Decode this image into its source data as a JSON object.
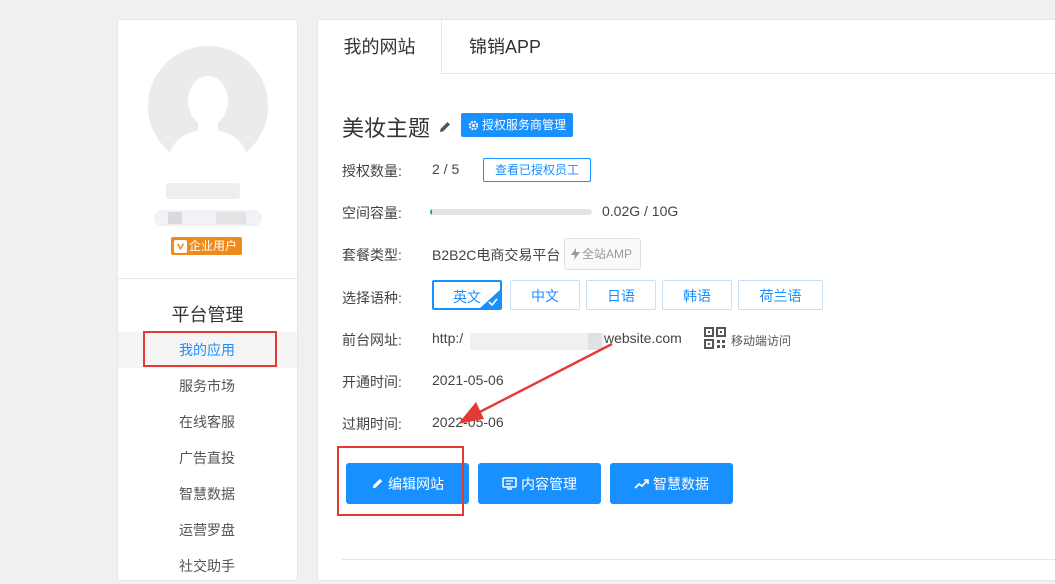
{
  "sidebar": {
    "badge": "企业用户",
    "title": "平台管理",
    "items": [
      {
        "label": "我的应用",
        "active": true
      },
      {
        "label": "服务市场"
      },
      {
        "label": "在线客服"
      },
      {
        "label": "广告直投"
      },
      {
        "label": "智慧数据"
      },
      {
        "label": "运营罗盘"
      },
      {
        "label": "社交助手"
      }
    ]
  },
  "tabs": [
    {
      "label": "我的网站",
      "active": true
    },
    {
      "label": "锦销APP"
    }
  ],
  "site": {
    "title": "美妆主题",
    "auth_button": "授权服务商管理",
    "auth_count_label": "授权数量:",
    "auth_count_value": "2 / 5",
    "view_staff_button": "查看已授权员工",
    "space_label": "空间容量:",
    "space_value": "0.02G / 10G",
    "space_used_fraction": 0.002,
    "plan_label": "套餐类型:",
    "plan_value": "B2B2C电商交易平台",
    "amp_tag": "全站AMP",
    "lang_label": "选择语种:",
    "languages": [
      "英文",
      "中文",
      "日语",
      "韩语",
      "荷兰语"
    ],
    "selected_language": "英文",
    "url_label": "前台网址:",
    "url_prefix": "http:/",
    "url_suffix": "website.com",
    "mobile_visit": "移动端访问",
    "open_label": "开通时间:",
    "open_value": "2021-05-06",
    "expire_label": "过期时间:",
    "expire_value": "2022-05-06"
  },
  "actions": {
    "edit": "编辑网站",
    "content": "内容管理",
    "data": "智慧数据"
  },
  "colors": {
    "primary": "#1890ff",
    "badge": "#f08a1c",
    "highlight": "#e53935",
    "progress": "#1aa97a"
  }
}
